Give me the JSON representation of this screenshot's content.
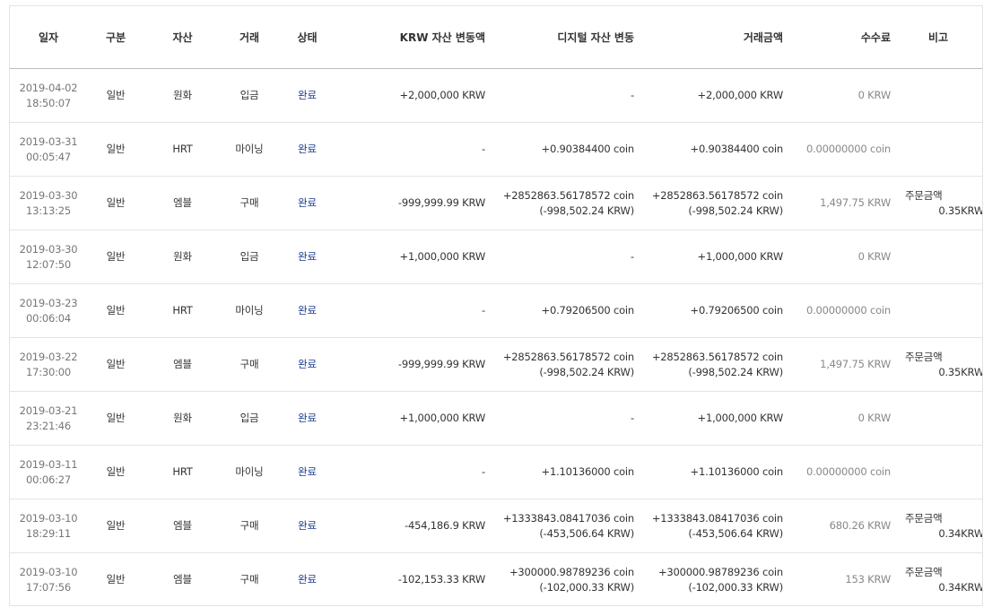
{
  "headers": {
    "date": "일자",
    "category": "구분",
    "asset": "자산",
    "trade": "거래",
    "status": "상태",
    "krw_change": "KRW 자산 변동액",
    "digital_change": "디지털 자산 변동",
    "trade_amount": "거래금액",
    "fee": "수수료",
    "note": "비고"
  },
  "rows": [
    {
      "date": "2019-04-02",
      "time": "18:50:07",
      "category": "일반",
      "asset": "원화",
      "trade": "입금",
      "status": "완료",
      "krw_change": "+2,000,000 KRW",
      "digital_1": "-",
      "digital_2": "",
      "amount_1": "+2,000,000 KRW",
      "amount_2": "",
      "fee": "0 KRW",
      "note_1": "",
      "note_2": ""
    },
    {
      "date": "2019-03-31",
      "time": "00:05:47",
      "category": "일반",
      "asset": "HRT",
      "trade": "마이닝",
      "status": "완료",
      "krw_change": "-",
      "digital_1": "+0.90384400 coin",
      "digital_2": "",
      "amount_1": "+0.90384400 coin",
      "amount_2": "",
      "fee": "0.00000000 coin",
      "note_1": "",
      "note_2": ""
    },
    {
      "date": "2019-03-30",
      "time": "13:13:25",
      "category": "일반",
      "asset": "엠블",
      "trade": "구매",
      "status": "완료",
      "krw_change": "-999,999.99 KRW",
      "digital_1": "+2852863.56178572 coin",
      "digital_2": "(-998,502.24 KRW)",
      "amount_1": "+2852863.56178572 coin",
      "amount_2": "(-998,502.24 KRW)",
      "fee": "1,497.75 KRW",
      "note_1": "주문금액",
      "note_2": "0.35KRW"
    },
    {
      "date": "2019-03-30",
      "time": "12:07:50",
      "category": "일반",
      "asset": "원화",
      "trade": "입금",
      "status": "완료",
      "krw_change": "+1,000,000 KRW",
      "digital_1": "-",
      "digital_2": "",
      "amount_1": "+1,000,000 KRW",
      "amount_2": "",
      "fee": "0 KRW",
      "note_1": "",
      "note_2": ""
    },
    {
      "date": "2019-03-23",
      "time": "00:06:04",
      "category": "일반",
      "asset": "HRT",
      "trade": "마이닝",
      "status": "완료",
      "krw_change": "-",
      "digital_1": "+0.79206500 coin",
      "digital_2": "",
      "amount_1": "+0.79206500 coin",
      "amount_2": "",
      "fee": "0.00000000 coin",
      "note_1": "",
      "note_2": ""
    },
    {
      "date": "2019-03-22",
      "time": "17:30:00",
      "category": "일반",
      "asset": "엠블",
      "trade": "구매",
      "status": "완료",
      "krw_change": "-999,999.99 KRW",
      "digital_1": "+2852863.56178572 coin",
      "digital_2": "(-998,502.24 KRW)",
      "amount_1": "+2852863.56178572 coin",
      "amount_2": "(-998,502.24 KRW)",
      "fee": "1,497.75 KRW",
      "note_1": "주문금액",
      "note_2": "0.35KRW"
    },
    {
      "date": "2019-03-21",
      "time": "23:21:46",
      "category": "일반",
      "asset": "원화",
      "trade": "입금",
      "status": "완료",
      "krw_change": "+1,000,000 KRW",
      "digital_1": "-",
      "digital_2": "",
      "amount_1": "+1,000,000 KRW",
      "amount_2": "",
      "fee": "0 KRW",
      "note_1": "",
      "note_2": ""
    },
    {
      "date": "2019-03-11",
      "time": "00:06:27",
      "category": "일반",
      "asset": "HRT",
      "trade": "마이닝",
      "status": "완료",
      "krw_change": "-",
      "digital_1": "+1.10136000 coin",
      "digital_2": "",
      "amount_1": "+1.10136000 coin",
      "amount_2": "",
      "fee": "0.00000000 coin",
      "note_1": "",
      "note_2": ""
    },
    {
      "date": "2019-03-10",
      "time": "18:29:11",
      "category": "일반",
      "asset": "엠블",
      "trade": "구매",
      "status": "완료",
      "krw_change": "-454,186.9 KRW",
      "digital_1": "+1333843.08417036 coin",
      "digital_2": "(-453,506.64 KRW)",
      "amount_1": "+1333843.08417036 coin",
      "amount_2": "(-453,506.64 KRW)",
      "fee": "680.26 KRW",
      "note_1": "주문금액",
      "note_2": "0.34KRW"
    },
    {
      "date": "2019-03-10",
      "time": "17:07:56",
      "category": "일반",
      "asset": "엠블",
      "trade": "구매",
      "status": "완료",
      "krw_change": "-102,153.33 KRW",
      "digital_1": "+300000.98789236 coin",
      "digital_2": "(-102,000.33 KRW)",
      "amount_1": "+300000.98789236 coin",
      "amount_2": "(-102,000.33 KRW)",
      "fee": "153 KRW",
      "note_1": "주문금액",
      "note_2": "0.34KRW"
    }
  ]
}
